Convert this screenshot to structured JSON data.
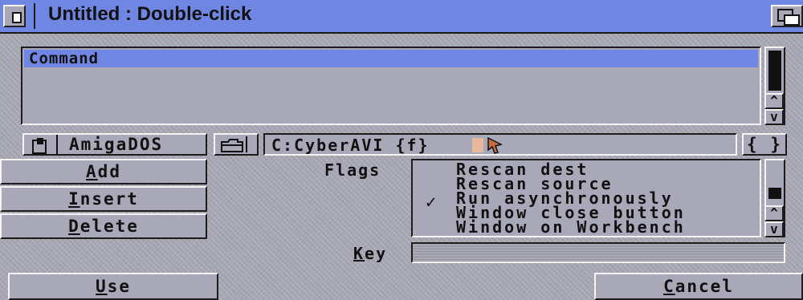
{
  "window": {
    "title": "Untitled : Double-click"
  },
  "command_list": {
    "items": [
      "Command"
    ]
  },
  "type_button": {
    "label": "AmigaDOS"
  },
  "command_field": {
    "value": "C:CyberAVI {f}"
  },
  "args_button": {
    "label": "{ }"
  },
  "buttons": {
    "add": {
      "first": "A",
      "rest": "dd"
    },
    "insert": {
      "first": "I",
      "rest": "nsert"
    },
    "delete": {
      "first": "D",
      "rest": "elete"
    },
    "use": {
      "first": "U",
      "rest": "se"
    },
    "cancel": {
      "first": "C",
      "rest": "ancel"
    }
  },
  "flags": {
    "label": "Flags",
    "items": [
      "Rescan dest",
      "Rescan source",
      "Run asynchronously",
      "Window close button",
      "Window on Workbench"
    ],
    "checked": "Run asynchronously"
  },
  "key": {
    "label_first": "K",
    "label_rest": "ey",
    "value": ""
  },
  "scroll": {
    "up": "^",
    "down": "v"
  },
  "icons": {
    "close": "close-icon",
    "depth": "depth-gadget-icon",
    "type": "amigados-type-icon",
    "file": "file-requester-icon",
    "check": "✓"
  }
}
